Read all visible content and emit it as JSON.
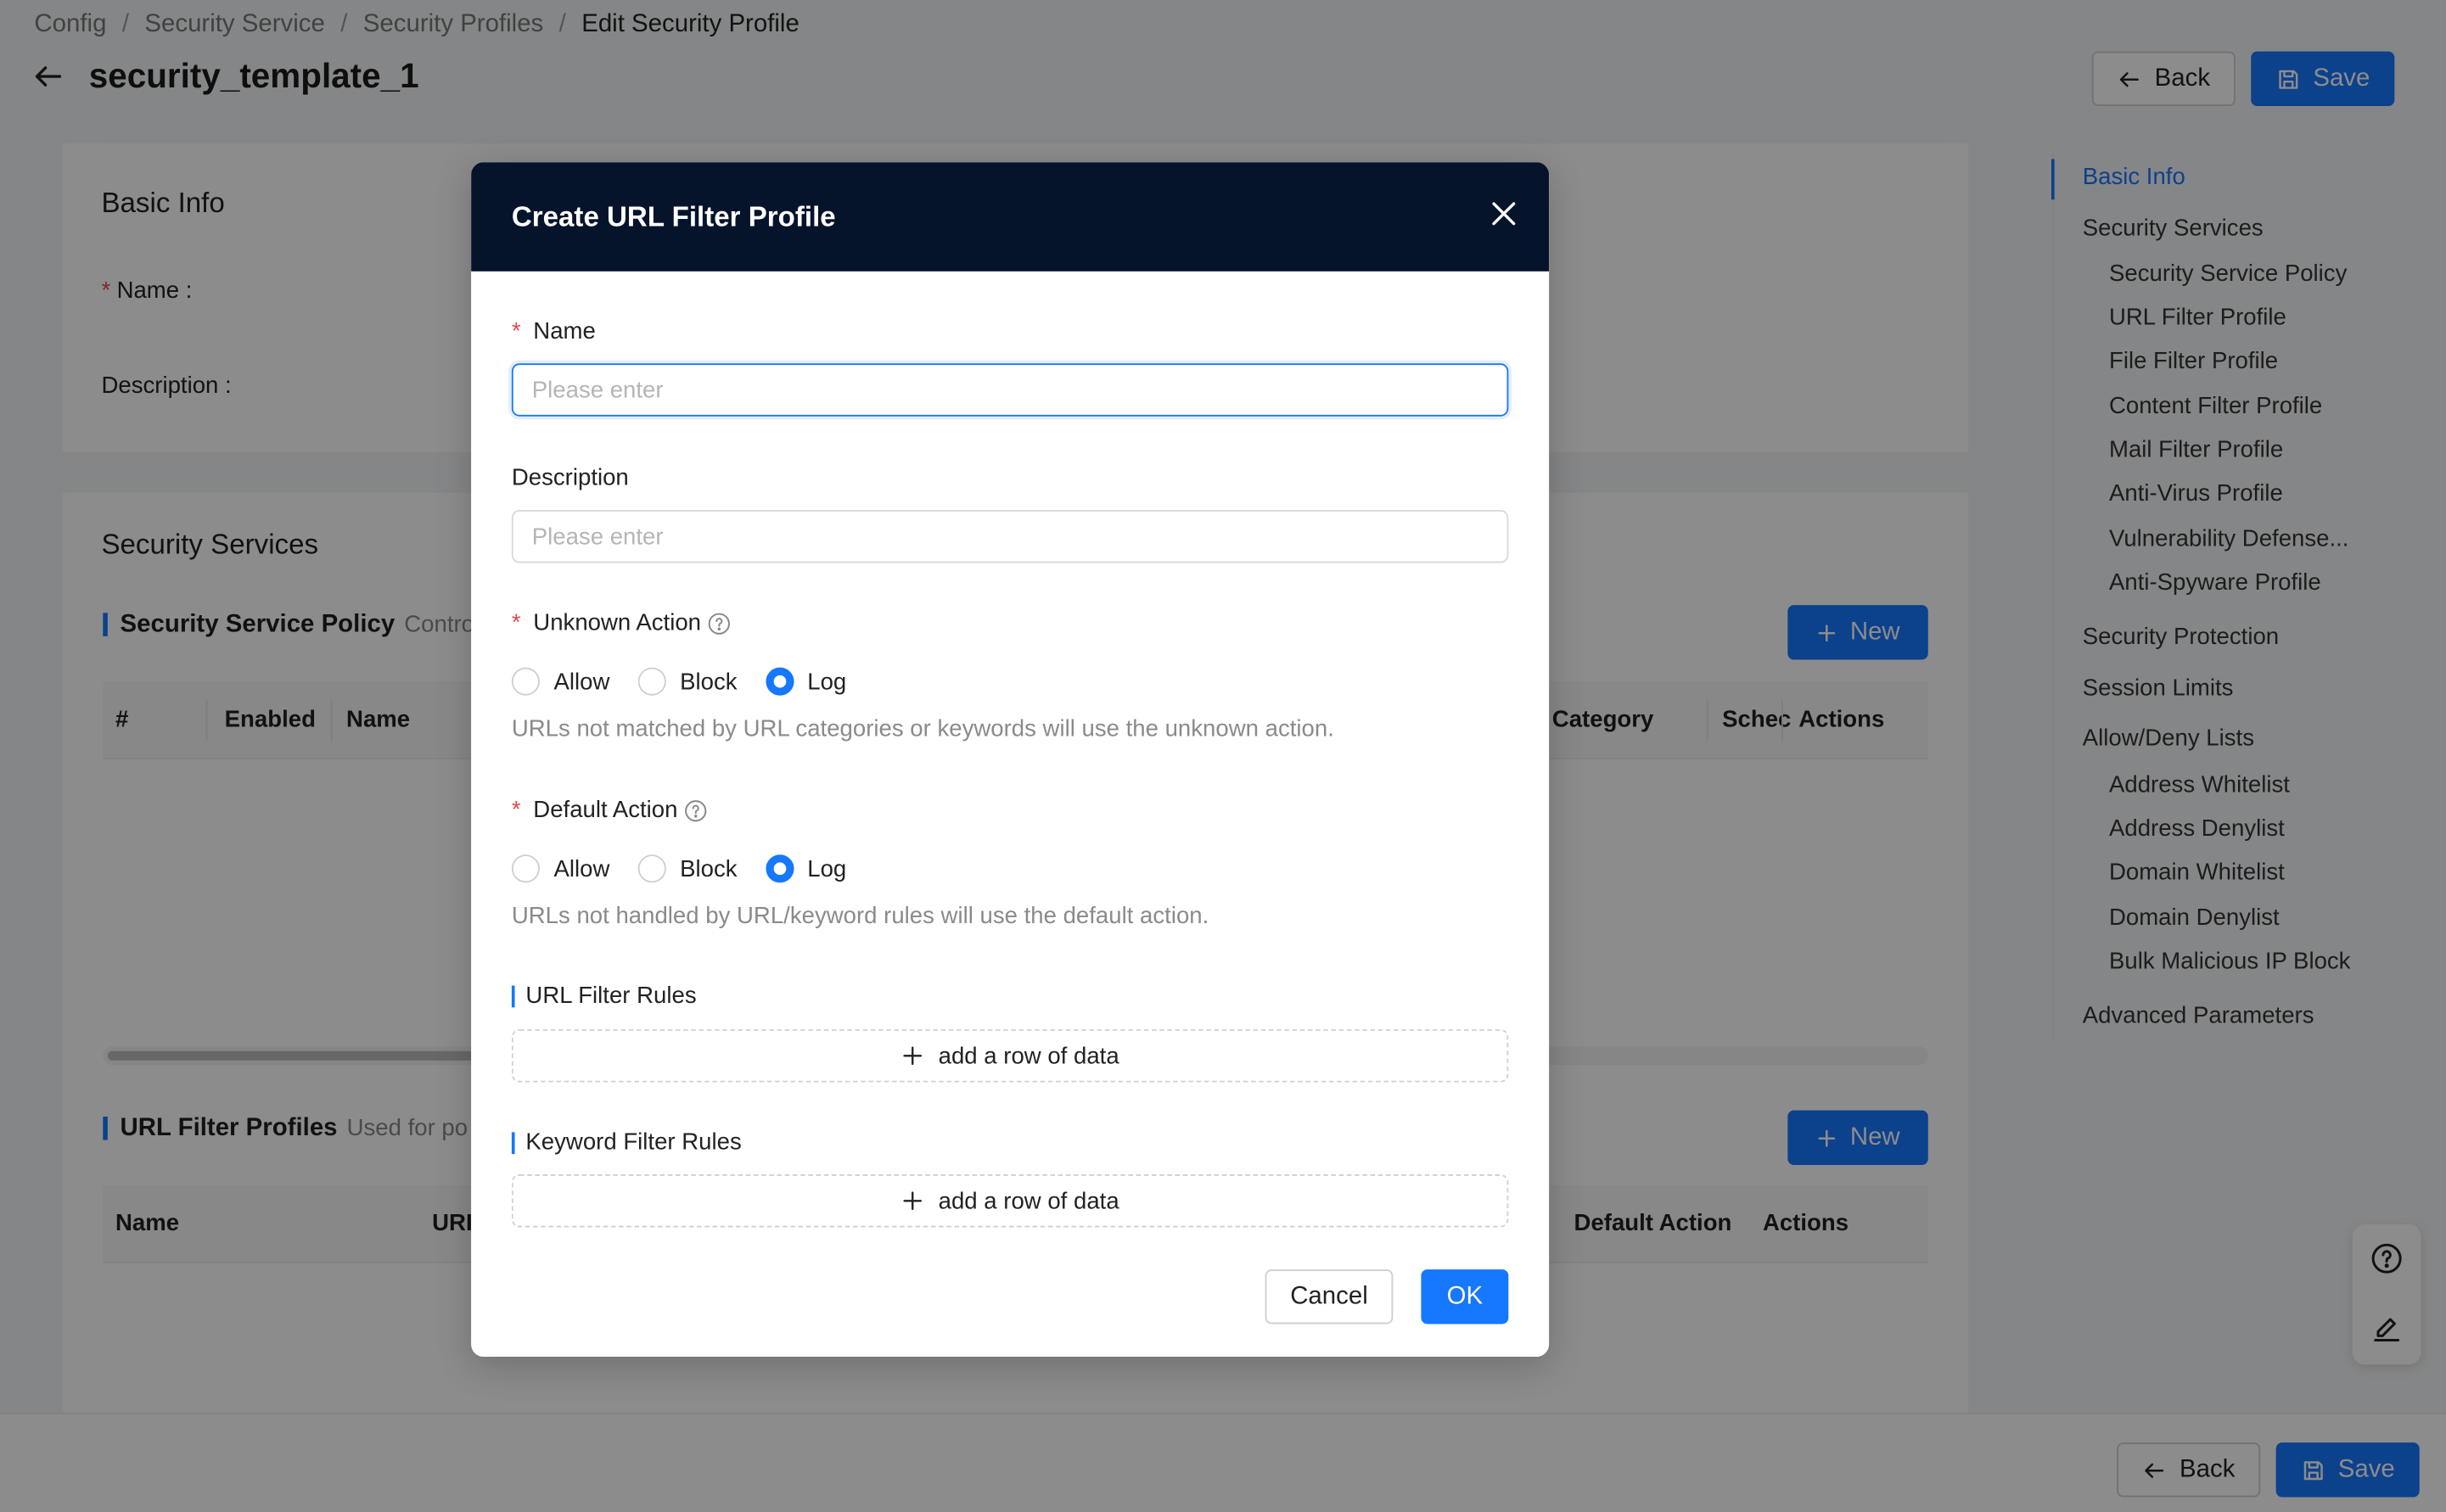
{
  "breadcrumb": [
    "Config",
    "Security Service",
    "Security Profiles",
    "Edit Security Profile"
  ],
  "breadcrumb_sep": "/",
  "page": {
    "title": "security_template_1"
  },
  "header_buttons": {
    "back": "Back",
    "save": "Save"
  },
  "footer_buttons": {
    "back": "Back",
    "save": "Save"
  },
  "basic_info": {
    "title": "Basic Info",
    "name_label": "Name :",
    "description_label": "Description :"
  },
  "security_services": {
    "title": "Security Services",
    "policy": {
      "title": "Security Service Policy",
      "desc": "Contro",
      "new_label": "New",
      "columns": [
        "#",
        "Enabled",
        "Name",
        "Category",
        "Schec",
        "Actions"
      ]
    },
    "url_filter_profiles": {
      "title": "URL Filter Profiles",
      "desc": "Used for po",
      "new_label": "New",
      "columns": [
        "Name",
        "URI",
        "Default Action",
        "Actions"
      ]
    }
  },
  "anchor_nav": [
    {
      "label": "Basic Info",
      "level": 1,
      "active": true
    },
    {
      "label": "Security Services",
      "level": 1
    },
    {
      "label": "Security Service Policy",
      "level": 2
    },
    {
      "label": "URL Filter Profile",
      "level": 2
    },
    {
      "label": "File Filter Profile",
      "level": 2
    },
    {
      "label": "Content Filter Profile",
      "level": 2
    },
    {
      "label": "Mail Filter Profile",
      "level": 2
    },
    {
      "label": "Anti-Virus Profile",
      "level": 2
    },
    {
      "label": "Vulnerability Defense...",
      "level": 2
    },
    {
      "label": "Anti-Spyware Profile",
      "level": 2
    },
    {
      "label": "Security Protection",
      "level": 1
    },
    {
      "label": "Session Limits",
      "level": 1
    },
    {
      "label": "Allow/Deny Lists",
      "level": 1
    },
    {
      "label": "Address Whitelist",
      "level": 2
    },
    {
      "label": "Address Denylist",
      "level": 2
    },
    {
      "label": "Domain Whitelist",
      "level": 2
    },
    {
      "label": "Domain Denylist",
      "level": 2
    },
    {
      "label": "Bulk Malicious IP Block",
      "level": 2
    },
    {
      "label": "Advanced Parameters",
      "level": 1
    }
  ],
  "modal": {
    "title": "Create URL Filter Profile",
    "name": {
      "label": "Name",
      "placeholder": "Please enter",
      "value": ""
    },
    "description": {
      "label": "Description",
      "placeholder": "Please enter",
      "value": ""
    },
    "unknown_action": {
      "label": "Unknown Action",
      "options": [
        "Allow",
        "Block",
        "Log"
      ],
      "selected": "Log",
      "help": "URLs not matched by URL categories or keywords will use the unknown action."
    },
    "default_action": {
      "label": "Default Action",
      "options": [
        "Allow",
        "Block",
        "Log"
      ],
      "selected": "Log",
      "help": "URLs not handled by URL/keyword rules will use the default action."
    },
    "url_filter_rules": {
      "title": "URL Filter Rules",
      "add_label": "add a row of data"
    },
    "keyword_filter_rules": {
      "title": "Keyword Filter Rules",
      "add_label": "add a row of data"
    },
    "cancel_label": "Cancel",
    "ok_label": "OK"
  },
  "colors": {
    "primary": "#1677ff",
    "modal_header": "#06142b",
    "required": "#e5484d"
  }
}
